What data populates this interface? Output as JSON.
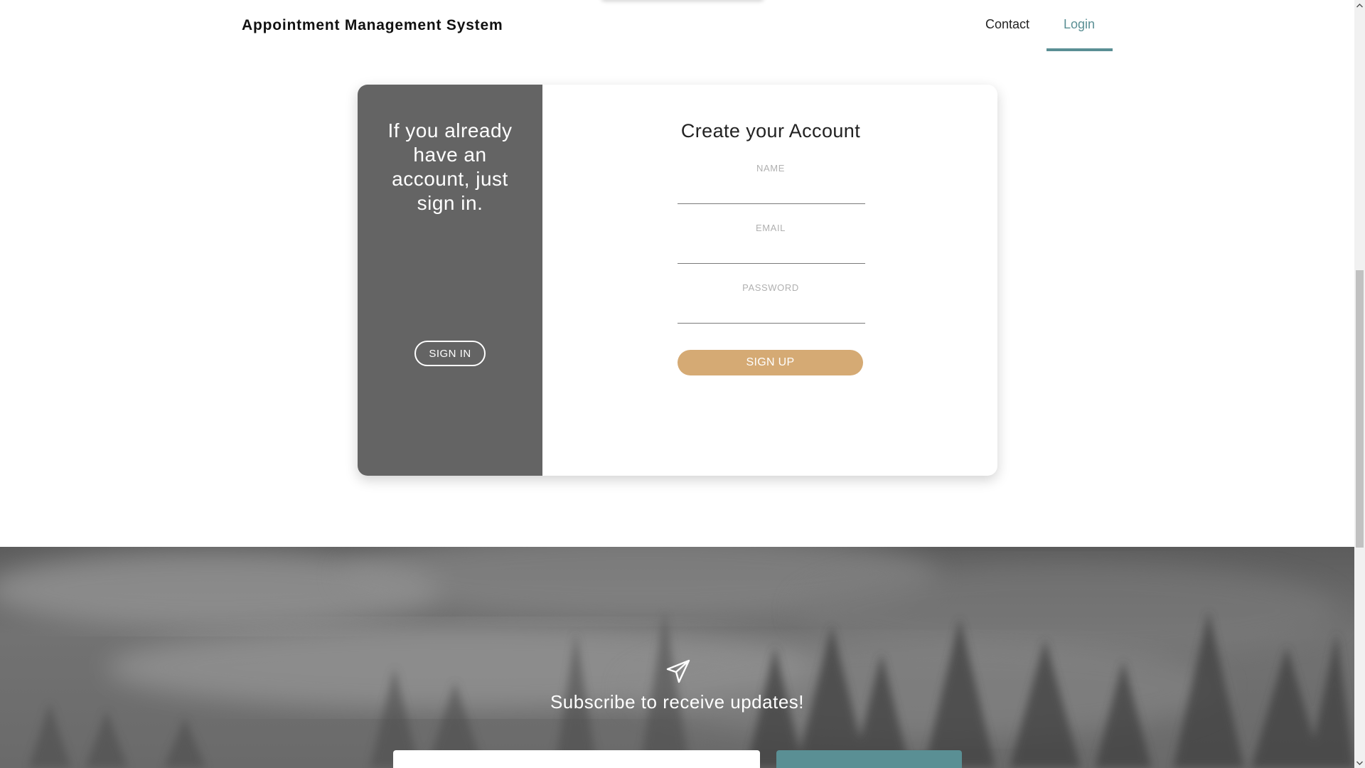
{
  "nav": {
    "brand": "Appointment Management System",
    "links": [
      {
        "label": "Contact"
      },
      {
        "label": "Login",
        "active": true
      }
    ],
    "accent_color": "#5a8f94"
  },
  "signin_panel": {
    "message": "If you already have an account, just sign in.",
    "button_label": "SIGN IN",
    "background_color": "#646464"
  },
  "signup_form": {
    "title": "Create your Account",
    "fields": [
      {
        "label": "NAME",
        "value": ""
      },
      {
        "label": "EMAIL",
        "value": ""
      },
      {
        "label": "PASSWORD",
        "value": ""
      }
    ],
    "submit_label": "SIGN UP",
    "submit_color": "#d5aa74"
  },
  "footer": {
    "icon": "paper-plane-icon",
    "subscribe_text": "Subscribe to receive updates!",
    "email_value": "",
    "button_color": "#5a8f94"
  }
}
